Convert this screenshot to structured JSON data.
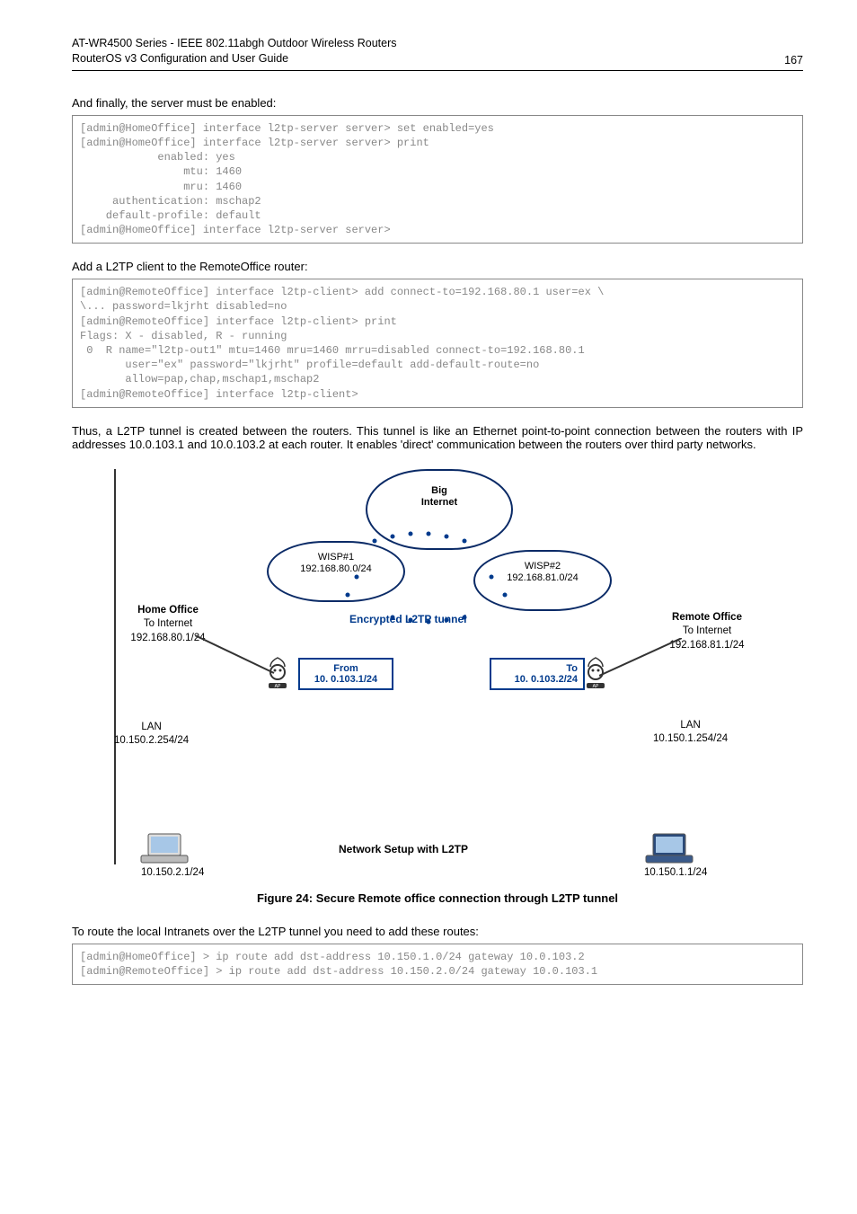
{
  "header": {
    "title_line1": "AT-WR4500 Series - IEEE 802.11abgh Outdoor Wireless Routers",
    "title_line2": "RouterOS v3 Configuration and User Guide",
    "page": "167"
  },
  "p1": "And finally, the server must be enabled:",
  "code1": "[admin@HomeOffice] interface l2tp-server server> set enabled=yes\n[admin@HomeOffice] interface l2tp-server server> print\n            enabled: yes\n                mtu: 1460\n                mru: 1460\n     authentication: mschap2\n    default-profile: default\n[admin@HomeOffice] interface l2tp-server server>",
  "p2": "Add a L2TP client to the RemoteOffice router:",
  "code2": "[admin@RemoteOffice] interface l2tp-client> add connect-to=192.168.80.1 user=ex \\\n\\... password=lkjrht disabled=no\n[admin@RemoteOffice] interface l2tp-client> print\nFlags: X - disabled, R - running\n 0  R name=\"l2tp-out1\" mtu=1460 mru=1460 mrru=disabled connect-to=192.168.80.1\n       user=\"ex\" password=\"lkjrht\" profile=default add-default-route=no\n       allow=pap,chap,mschap1,mschap2\n[admin@RemoteOffice] interface l2tp-client>",
  "p3": "Thus, a L2TP tunnel is created between the routers. This tunnel is like an Ethernet point-to-point connection between the routers with IP addresses 10.0.103.1 and 10.0.103.2 at each router. It enables 'direct' communication between the routers over third party networks.",
  "diagram": {
    "big_cloud_l1": "Big",
    "big_cloud_l2": "Internet",
    "wisp1_l1": "WISP#1",
    "wisp1_l2": "192.168.80.0/24",
    "wisp2_l1": "WISP#2",
    "wisp2_l2": "192.168.81.0/24",
    "home_l1": "Home Office",
    "home_l2": "To Internet",
    "home_l3": "192.168.80.1/24",
    "remote_l1": "Remote Office",
    "remote_l2": "To Internet",
    "remote_l3": "192.168.81.1/24",
    "enc": "Encrypted L2TP tunnel",
    "from_l1": "From",
    "from_l2": "10. 0.103.1/24",
    "to_l1": "To",
    "to_l2": "10. 0.103.2/24",
    "lan_l_l1": "LAN",
    "lan_l_l2": "10.150.2.254/24",
    "lan_r_l1": "LAN",
    "lan_r_l2": "10.150.1.254/24",
    "ip_bl": "10.150.2.1/24",
    "ip_br": "10.150.1.1/24",
    "net_label": "Network Setup with L2TP"
  },
  "fig_caption": "Figure 24: Secure Remote office connection through L2TP tunnel",
  "p4": "To route the local Intranets over the L2TP tunnel you need to add these routes:",
  "code3": "[admin@HomeOffice] > ip route add dst-address 10.150.1.0/24 gateway 10.0.103.2\n[admin@RemoteOffice] > ip route add dst-address 10.150.2.0/24 gateway 10.0.103.1"
}
